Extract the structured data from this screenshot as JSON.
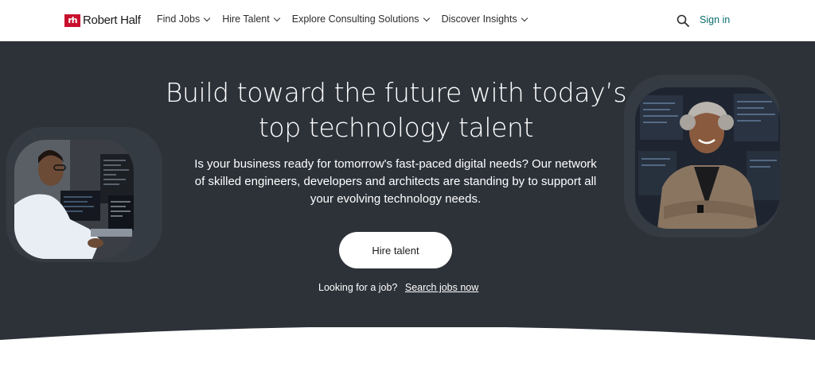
{
  "brand": {
    "name": "Robert Half",
    "mark": "rh",
    "color": "#c8102e"
  },
  "nav": [
    {
      "label": "Find Jobs"
    },
    {
      "label": "Hire Talent"
    },
    {
      "label": "Explore Consulting Solutions"
    },
    {
      "label": "Discover Insights"
    }
  ],
  "header": {
    "search_icon": "search-icon",
    "signin_label": "Sign in"
  },
  "hero": {
    "title_line1": "Build toward the future with today’s",
    "title_line2": "top technology talent",
    "sub_line1": "Is your business ready for tomorrow's fast-paced digital needs? Our network",
    "sub_line2": "of skilled engineers, developers and architects are standing by to support all",
    "sub_line3": "your evolving technology needs.",
    "cta_label": "Hire talent",
    "job_prompt": "Looking for a job?",
    "job_link": "Search jobs now"
  },
  "colors": {
    "hero_bg": "#2d3239",
    "accent": "#0b6e6e"
  }
}
